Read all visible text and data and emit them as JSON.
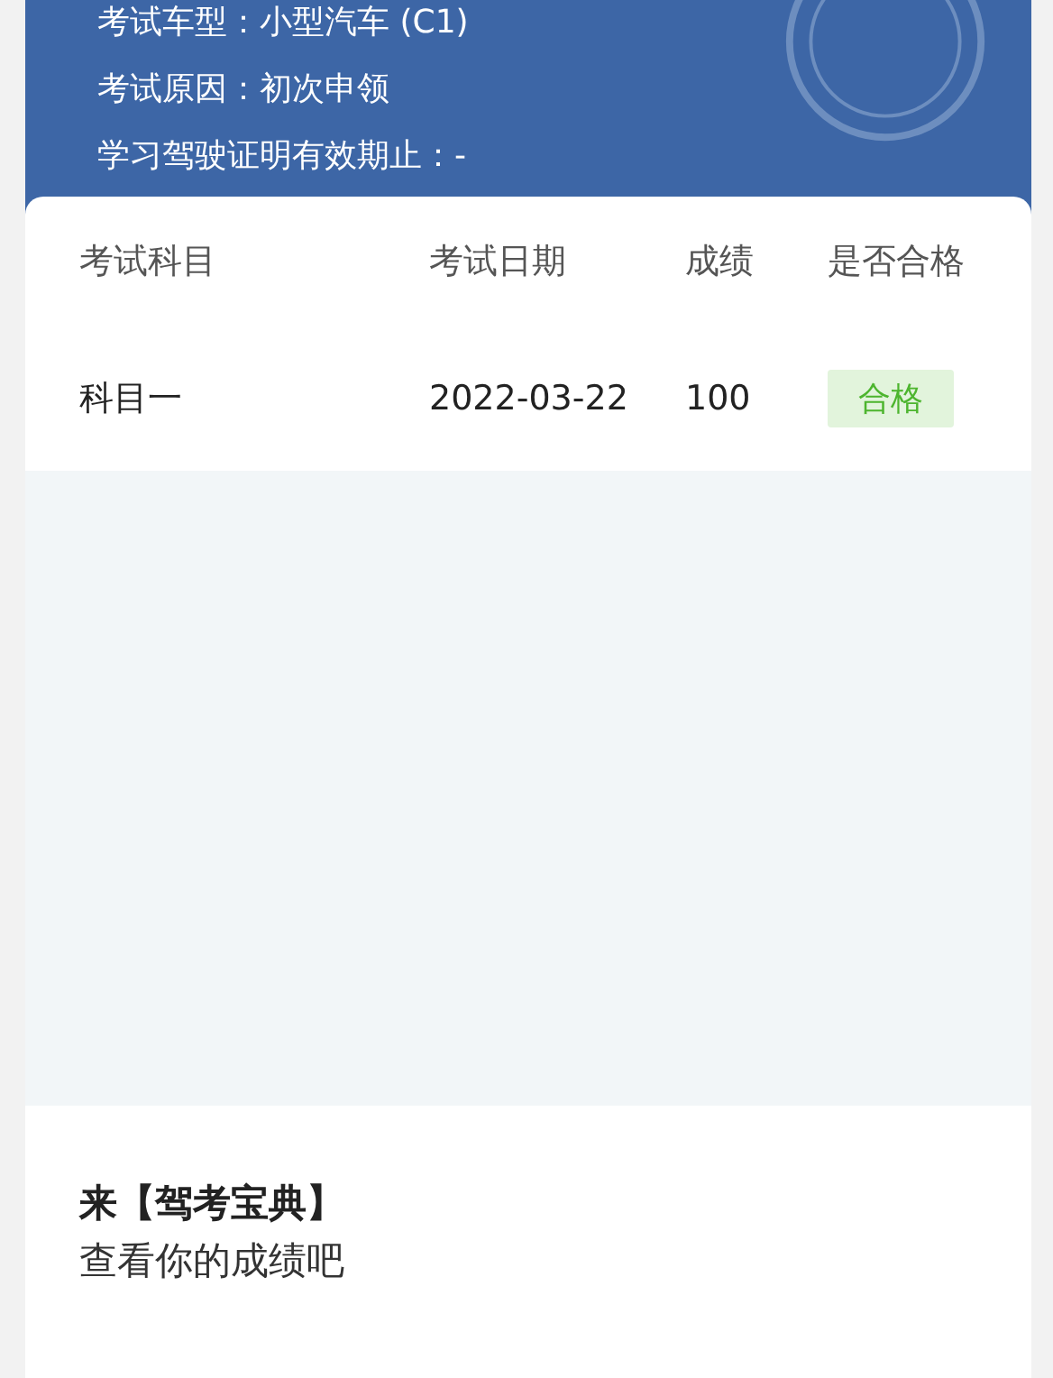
{
  "header": {
    "lines": [
      {
        "label": "考试车型：",
        "value": "小型汽车 (C1)"
      },
      {
        "label": "考试原因：",
        "value": "初次申领"
      },
      {
        "label": "学习驾驶证明有效期止：",
        "value": "-"
      }
    ]
  },
  "table": {
    "columns": [
      "考试科目",
      "考试日期",
      "成绩",
      "是否合格"
    ],
    "rows": [
      {
        "subject": "科目一",
        "date": "2022-03-22",
        "score": "100",
        "result": "合格",
        "passed": true
      }
    ]
  },
  "promo": {
    "title": "来【驾考宝典】",
    "subtitle": "查看你的成绩吧"
  }
}
